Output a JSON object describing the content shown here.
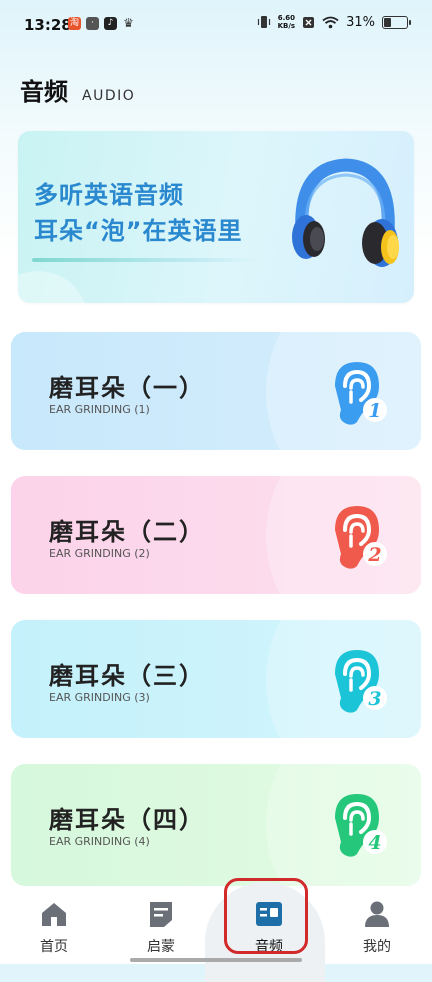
{
  "status_bar": {
    "time": "13:28",
    "net_speed_value": "6.60",
    "net_speed_unit": "KB/s",
    "battery_percent": "31%",
    "battery_level": 0.31
  },
  "header": {
    "title": "音频",
    "subtitle": "AUDIO"
  },
  "banner": {
    "line1": "多听英语音频",
    "line2": "耳朵“泡”在英语里"
  },
  "cards": [
    {
      "title": "磨耳朵（一）",
      "subtitle": "EAR GRINDING (1)",
      "number": "1",
      "color": "#3b9df0"
    },
    {
      "title": "磨耳朵（二）",
      "subtitle": "EAR GRINDING (2)",
      "number": "2",
      "color": "#ef5a4c"
    },
    {
      "title": "磨耳朵（三）",
      "subtitle": "EAR GRINDING (3)",
      "number": "3",
      "color": "#1cc4d8"
    },
    {
      "title": "磨耳朵（四）",
      "subtitle": "EAR GRINDING (4)",
      "number": "4",
      "color": "#25c77a"
    }
  ],
  "nav": [
    {
      "label": "首页",
      "icon": "home-icon"
    },
    {
      "label": "启蒙",
      "icon": "book-icon"
    },
    {
      "label": "音频",
      "icon": "audio-icon",
      "active": true
    },
    {
      "label": "我的",
      "icon": "person-icon"
    }
  ]
}
